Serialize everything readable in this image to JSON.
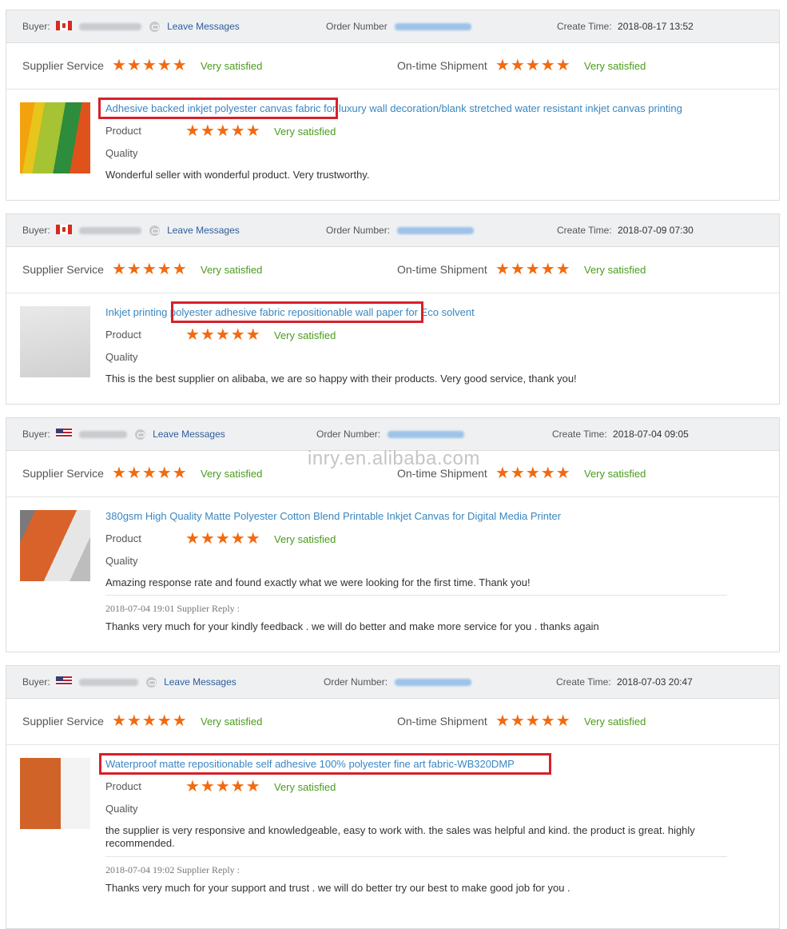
{
  "labels": {
    "buyer": "Buyer:",
    "leave_messages": "Leave Messages",
    "order_number": "Order Number:",
    "create_time": "Create Time:",
    "supplier_service": "Supplier Service",
    "ontime_shipment": "On-time Shipment",
    "very_satisfied": "Very satisfied",
    "product": "Product",
    "quality": "Quality",
    "stars": "★★★★★",
    "star_rating": 5
  },
  "watermark": "inry.en.alibaba.com",
  "reviews": [
    {
      "order_label": "Order Number",
      "create_time": "2018-08-17 13:52",
      "product_title": "Adhesive backed inkjet polyester canvas fabric for luxury wall decoration/blank stretched water resistant inkjet canvas printing",
      "comment": "Wonderful seller with wonderful product. Very trustworthy."
    },
    {
      "order_label": "Order Number:",
      "create_time": "2018-07-09 07:30",
      "product_title": "Inkjet printing polyester adhesive fabric repositionable wall paper for Eco solvent",
      "comment": "This is the best supplier on alibaba, we are so happy with their products. Very good service, thank you!"
    },
    {
      "order_label": "Order Number:",
      "create_time": "2018-07-04 09:05",
      "product_title": "380gsm High Quality Matte Polyester Cotton Blend Printable Inkjet Canvas for Digital Media Printer",
      "comment": "Amazing response rate and found exactly what we were looking for the first time. Thank you!",
      "reply_meta": "2018-07-04 19:01  Supplier Reply :",
      "reply": "Thanks very much for your kindly feedback . we will do better and make more service for you . thanks again"
    },
    {
      "order_label": "Order Number:",
      "create_time": "2018-07-03 20:47",
      "product_title": "Waterproof matte repositionable self adhesive 100% polyester fine art fabric-WB320DMP",
      "comment": "the supplier is very responsive and knowledgeable, easy to work with. the sales was helpful and kind. the product is great. highly recommended.",
      "reply_meta": "2018-07-04 19:02  Supplier Reply :",
      "reply": "Thanks very much for your support and trust . we will do better try our best to make good job for you ."
    }
  ]
}
